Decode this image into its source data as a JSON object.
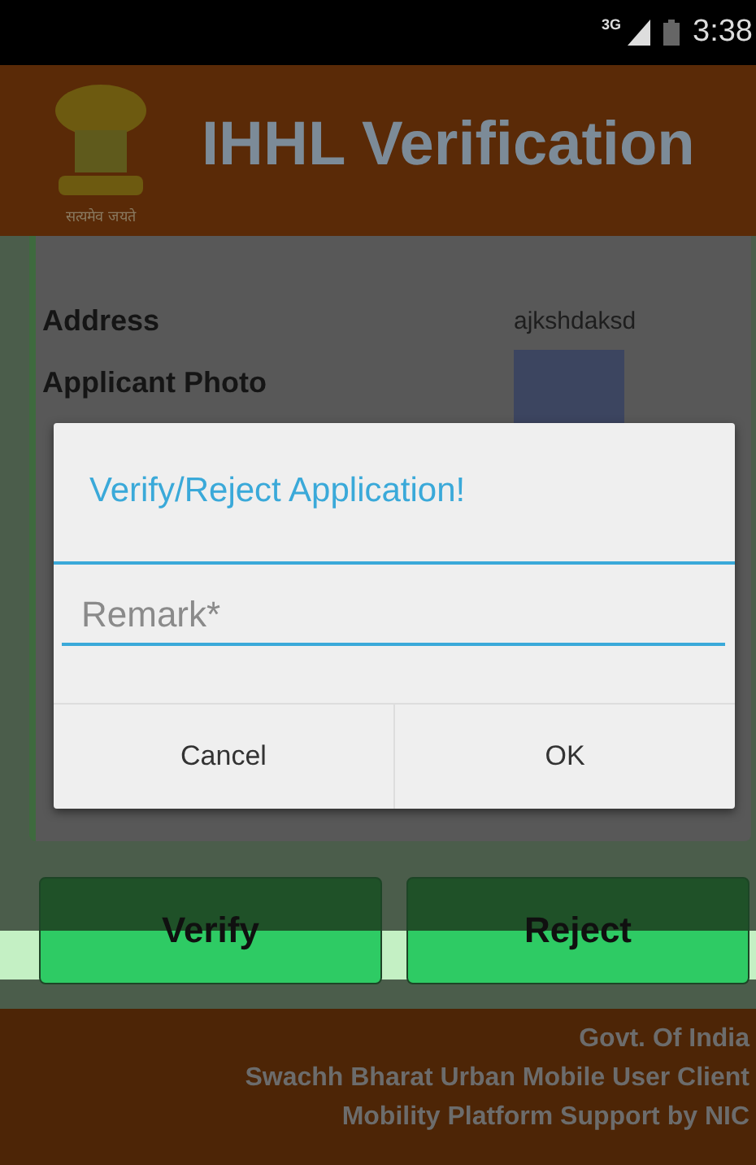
{
  "status_bar": {
    "network": "3G",
    "time": "3:38"
  },
  "header": {
    "motto": "सत्यमेव जयते",
    "title": "IHHL Verification"
  },
  "details": [
    {
      "kind": "text",
      "label": "Address",
      "value": "ajkshdaksd"
    },
    {
      "kind": "photo",
      "label": "Applicant Photo"
    }
  ],
  "actions": [
    {
      "label": "Verify"
    },
    {
      "label": "Reject"
    }
  ],
  "footer": [
    "Govt. Of India",
    "Swachh Bharat Urban Mobile User Client",
    "Mobility Platform Support by NIC"
  ],
  "dialog": {
    "title": "Verify/Reject Application!",
    "placeholder": "Remark*",
    "buttons": [
      "Cancel",
      "OK"
    ]
  }
}
